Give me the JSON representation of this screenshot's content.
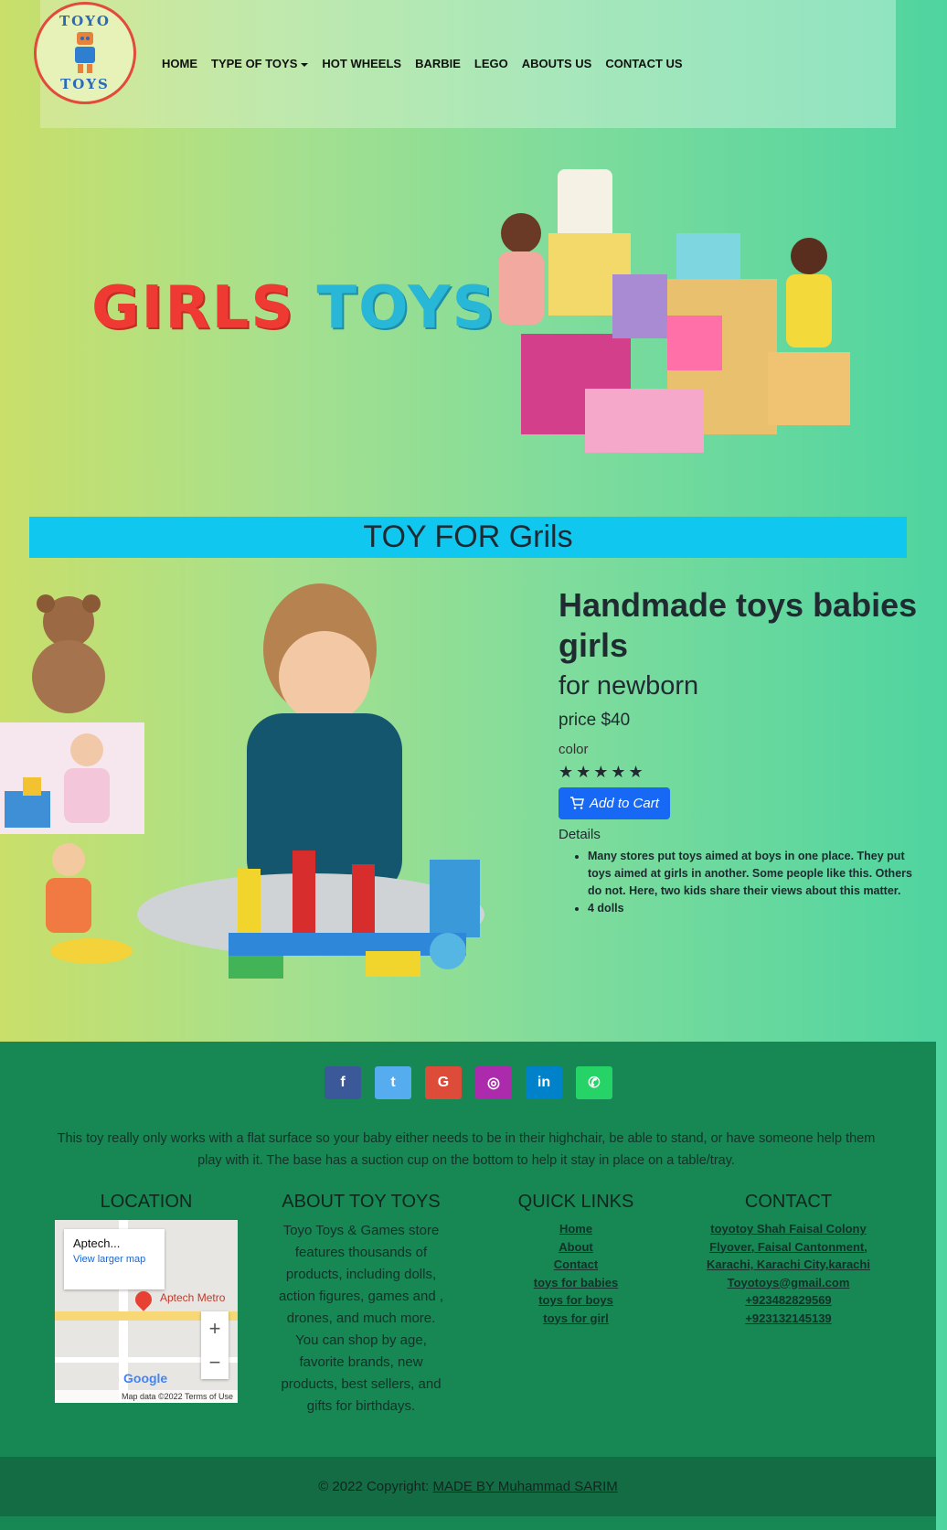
{
  "logo": {
    "top_text": "TOYO",
    "bottom_text": "TOYS"
  },
  "nav": {
    "items": [
      "HOME",
      "TYPE OF TOYS",
      "HOT WHEELS",
      "BARBIE",
      "LEGO",
      "ABOUTS US",
      "CONTACT US"
    ]
  },
  "hero": {
    "word1": "GIRLS",
    "word2": "TOYS"
  },
  "section_title": "TOY FOR Grils",
  "product": {
    "title": "Handmade toys babies girls",
    "subtitle": "for newborn",
    "price": "price $40",
    "color_label": "color",
    "stars": "★★★★★",
    "cart_button": "Add to Cart",
    "details_label": "Details",
    "details": [
      "Many stores put toys aimed at boys in one place. They put toys aimed at girls in another. Some people like this. Others do not. Here, two kids share their views about this matter.",
      "4 dolls"
    ]
  },
  "footer": {
    "socials": [
      {
        "name": "facebook-icon",
        "glyph": "f",
        "color": "#3b5998"
      },
      {
        "name": "twitter-icon",
        "glyph": "t",
        "color": "#55acee"
      },
      {
        "name": "google-icon",
        "glyph": "G",
        "color": "#dd4b39"
      },
      {
        "name": "instagram-icon",
        "glyph": "◎",
        "color": "#ac2bac"
      },
      {
        "name": "linkedin-icon",
        "glyph": "in",
        "color": "#0082ca"
      },
      {
        "name": "whatsapp-icon",
        "glyph": "✆",
        "color": "#25d366"
      }
    ],
    "text": "This toy really only works with a flat surface so your baby either needs to be in their highchair, be able to stand, or have someone help them play with it. The base has a suction cup on the bottom to help it stay in place on a table/tray.",
    "location_title": "LOCATION",
    "map": {
      "place": "Aptech...",
      "view_larger": "View larger map",
      "marker_label": "Aptech Metro",
      "zoom_in": "+",
      "zoom_out": "−",
      "brand": "Google",
      "attribution": "Map data ©2022   Terms of Use"
    },
    "about_title": "ABOUT TOY TOYS",
    "about_text": "Toyo Toys & Games store features thousands of products, including dolls, action figures, games and , drones, and much more. You can shop by age, favorite brands, new products, best sellers, and gifts for birthdays.",
    "links_title": "QUICK LINKS",
    "links": [
      "Home",
      "About",
      "Contact",
      "toys for babies",
      "toys for boys",
      "toys for girl"
    ],
    "contact_title": "CONTACT",
    "contact": [
      "toyotoy Shah Faisal Colony Flyover, Faisal Cantonment, Karachi, Karachi City,karachi",
      "Toyotoys@gmail.com",
      "+923482829569",
      "+923132145139"
    ],
    "copyright_prefix": "© 2022 Copyright:",
    "copyright_link": "MADE BY Muhammad SARIM"
  },
  "colors": {
    "section_bar": "#10c8ef",
    "footer": "#178753",
    "cart_button": "#1668f5",
    "hero_red": "#ee3a32",
    "hero_blue": "#28b7d6"
  }
}
